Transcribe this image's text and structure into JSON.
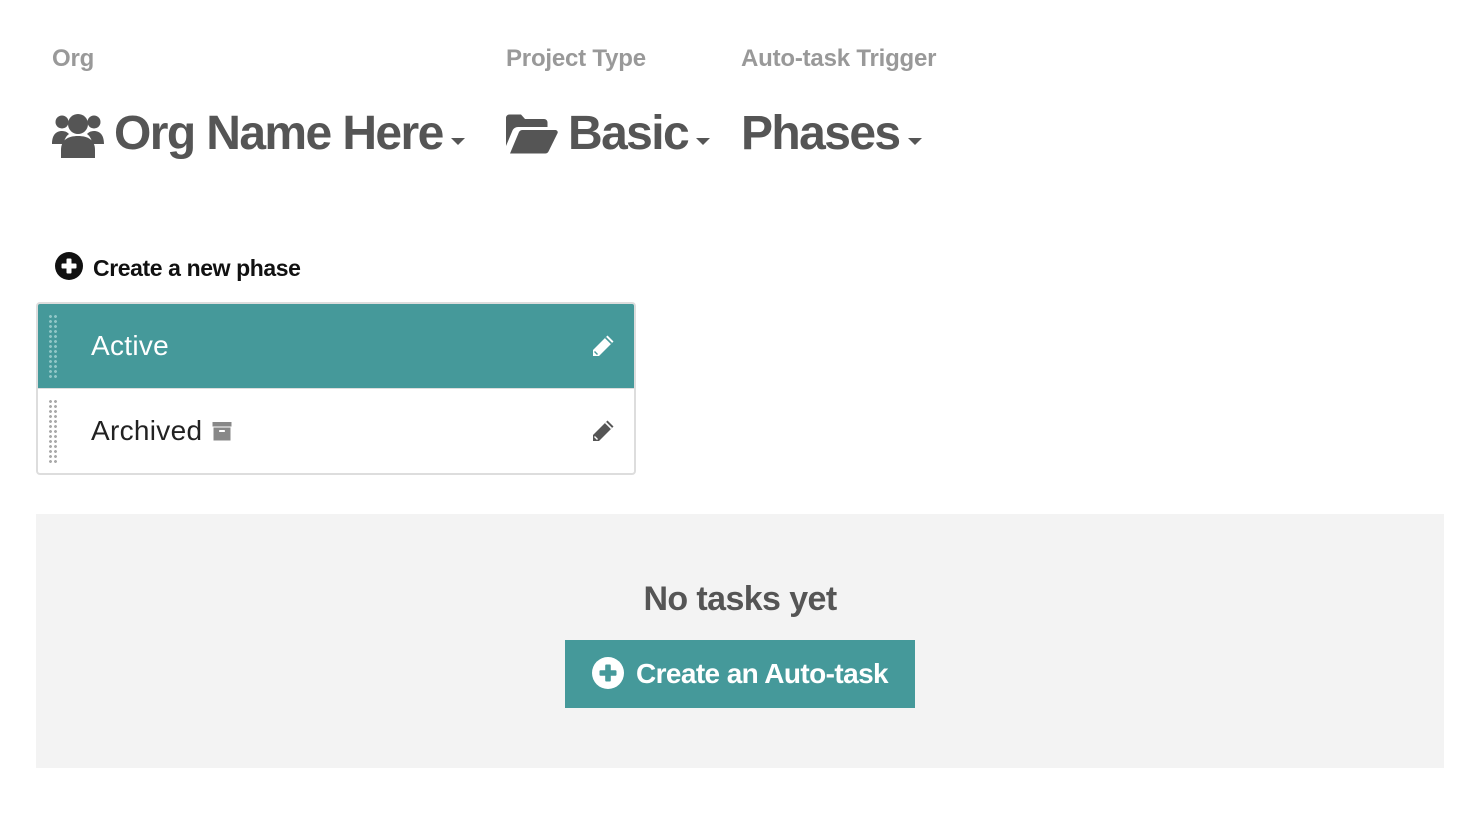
{
  "header": {
    "org": {
      "label": "Org",
      "value": "Org Name Here",
      "icon": "users-icon"
    },
    "project_type": {
      "label": "Project Type",
      "value": "Basic",
      "icon": "folder-open-icon"
    },
    "auto_task_trigger": {
      "label": "Auto-task Trigger",
      "value": "Phases"
    }
  },
  "phases": {
    "create_label": "Create a new phase",
    "items": [
      {
        "name": "Active",
        "selected": true,
        "archived": false
      },
      {
        "name": "Archived",
        "selected": false,
        "archived": true
      }
    ]
  },
  "tasks": {
    "empty_text": "No tasks yet",
    "create_button_label": "Create an Auto-task"
  },
  "colors": {
    "accent": "#45999a",
    "text": "#555555",
    "muted_label": "#999999",
    "panel_bg": "#f3f3f3"
  }
}
